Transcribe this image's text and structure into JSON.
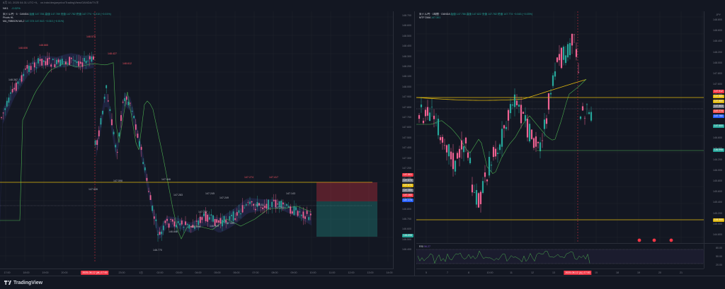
{
  "header": {
    "status_line": "8月 10, 2025 04:31 UTC+9、 xn.trdn/desjoeynbo/TradingView/OANDA/TVネ",
    "symbol": "NK1",
    "change": "-0.02%"
  },
  "left_chart": {
    "title": "米ドル/円 · 5 · OANDA",
    "ohlc": "始値 147.784 高値 147.789 安値 147.782 終値 147.774 −0.010 (−0.01%)",
    "indicator1": "Pivots HL",
    "indicator2": "MA_RIBBON MA,2",
    "indicator2_values": "147.374  147.813  −0.010 (−0.01%)",
    "y_ticks": [
      "148.700",
      "148.600",
      "148.500",
      "148.400",
      "148.300",
      "148.200",
      "148.100",
      "148.000",
      "147.900",
      "147.800",
      "147.700",
      "147.600",
      "147.500",
      "147.400",
      "147.300",
      "147.200",
      "147.100",
      "147.000",
      "146.900",
      "146.800",
      "146.700",
      "146.600",
      "146.500",
      "146.400"
    ],
    "x_ticks": [
      "17:00",
      "18:00",
      "19:00",
      "20:00",
      "21:00",
      "22:00",
      "23:00",
      "1日",
      "02:00",
      "03:00",
      "04:00",
      "05:00",
      "06:00",
      "07:00",
      "08:00",
      "09:00",
      "10:00",
      "11:00",
      "12:00",
      "13:00",
      "14:00"
    ],
    "now_label": "2025-08-12 (木) 17:00",
    "callouts_high": [
      "148.606",
      "148.665",
      "148.579",
      "148.427",
      "148.612",
      "147.274",
      "147.417"
    ],
    "callouts_low": [
      "148.397",
      "147.806",
      "147.598",
      "147.046",
      "146.770",
      "146.848",
      "146.894",
      "146.949",
      "147.089"
    ],
    "misc_labels": [
      "147.283",
      "147.245",
      "147.249",
      "147.151",
      "147.293",
      "147.227",
      "147.143"
    ],
    "price_tags": [
      {
        "label": "147.801",
        "color": "#f23645"
      },
      {
        "label": "147.674",
        "color": "#787b86"
      },
      {
        "label": "147.673",
        "color": "#e0b80e"
      },
      {
        "label": "147.354",
        "color": "#787b86"
      },
      {
        "label": "147.283",
        "color": "#f23645"
      },
      {
        "label": "147.174",
        "color": "#2962ff"
      },
      {
        "label": "146.898",
        "color": "#26a69a"
      }
    ]
  },
  "right_chart": {
    "title": "米ドル/円 · 1時間 · OANDA",
    "ohlc": "始値 147.766 高値 147.822 安値 147.782 終値 147.774 −0.043 (−0.03%)",
    "indicator": "MTF DMA",
    "indicator_value": "147.301",
    "currency": "JPY",
    "y_ticks": [
      "148.800",
      "148.600",
      "148.400",
      "148.200",
      "148.000",
      "147.800",
      "147.600",
      "147.400",
      "147.200",
      "147.000",
      "146.800",
      "146.600",
      "146.400",
      "146.200",
      "146.000",
      "145.800",
      "145.600",
      "145.400",
      "145.200",
      "145.000",
      "144.800"
    ],
    "x_ticks": [
      "5",
      "7",
      "8",
      "10:00",
      "11",
      "12",
      "13",
      "14",
      "15",
      "18",
      "19",
      "20",
      "21"
    ],
    "now_label": "2025-08-12 (火) 17:00",
    "price_tags": [
      {
        "label": "147.912",
        "color": "#f23645"
      },
      {
        "label": "147.880",
        "color": "#e0b80e"
      },
      {
        "label": "147.850",
        "color": "#e0b80e"
      },
      {
        "label": "147.803",
        "color": "#787b86"
      },
      {
        "label": "147.774",
        "color": "#ef5350"
      },
      {
        "label": "147.760",
        "color": "#2962ff"
      },
      {
        "label": "147.600",
        "color": "#26a69a"
      },
      {
        "label": "146.998",
        "color": "#26a69a"
      },
      {
        "label": "144.959",
        "color": "#e0b80e"
      }
    ],
    "rsi_label": "RSI",
    "rsi_value": "56.27",
    "rsi_ticks": [
      "80.00",
      "50.00",
      "20.00"
    ]
  },
  "footer": {
    "brand": "TradingView"
  }
}
